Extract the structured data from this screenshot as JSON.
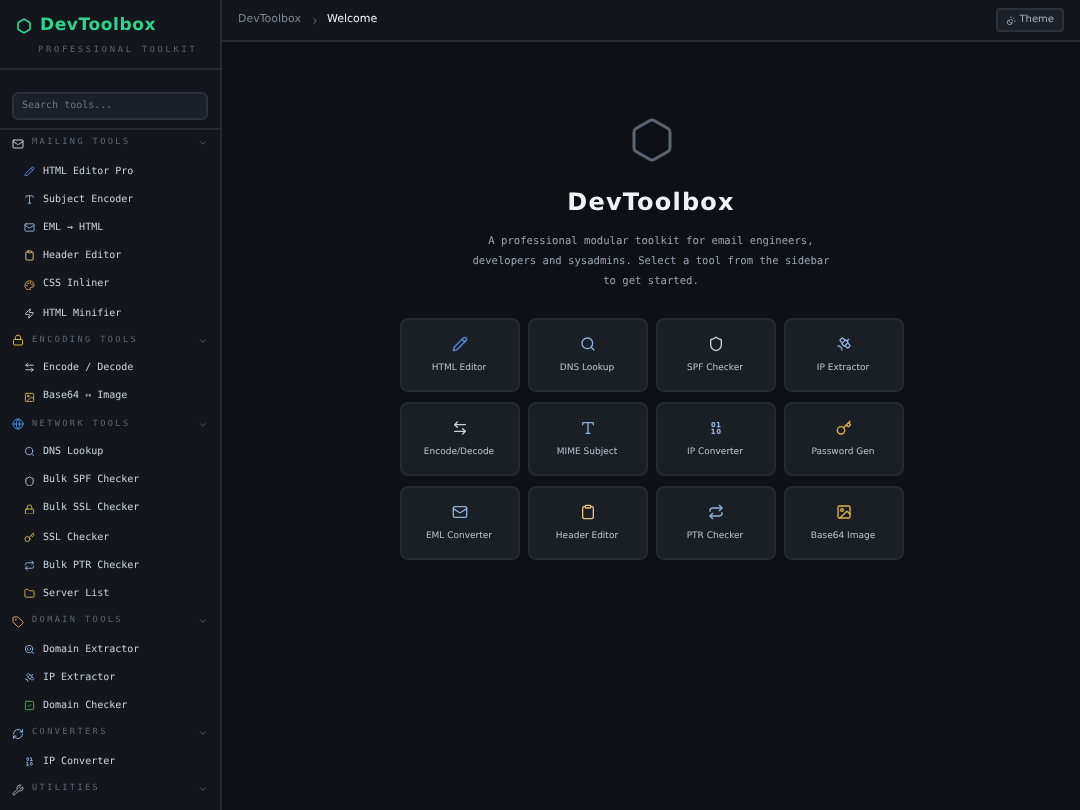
{
  "sidebar": {
    "logo": "DevToolbox",
    "subtitle": "PROFESSIONAL TOOLKIT",
    "search": {
      "placeholder": "Search tools..."
    },
    "sections": [
      {
        "title": "MAILING TOOLS",
        "expanded": true,
        "items": [
          "HTML Editor Pro",
          "Subject Encoder",
          "EML → HTML",
          "Header Editor",
          "CSS Inliner",
          "HTML Minifier"
        ]
      },
      {
        "title": "ENCODING TOOLS",
        "expanded": true,
        "items": [
          "Encode / Decode",
          "Base64 ⇔ Image"
        ]
      },
      {
        "title": "NETWORK TOOLS",
        "expanded": true,
        "items": [
          "DNS Lookup",
          "Bulk SPF Checker",
          "Bulk SSL Checker",
          "SSL Checker",
          "Bulk PTR Checker",
          "Server List"
        ]
      },
      {
        "title": "DOMAIN TOOLS",
        "expanded": true,
        "items": [
          "Domain Extractor",
          "IP Extractor",
          "Domain Checker"
        ]
      },
      {
        "title": "CONVERTERS",
        "expanded": true,
        "items": [
          "IP Converter"
        ]
      },
      {
        "title": "UTILITIES",
        "expanded": true
      }
    ]
  },
  "header": {
    "breadcrumb": [
      "DevToolbox",
      "Welcome"
    ],
    "theme_button": "Theme"
  },
  "welcome": {
    "title": "DevToolbox",
    "description": "A professional modular toolkit for email engineers, developers and sysadmins. Select a tool from the sidebar to get started.",
    "tools": [
      "HTML Editor",
      "DNS Lookup",
      "SPF Checker",
      "IP Extractor",
      "Encode/Decode",
      "MIME Subject",
      "IP Converter",
      "Password Gen",
      "EML Converter",
      "Header Editor",
      "PTR Checker",
      "Base64 Image"
    ]
  }
}
